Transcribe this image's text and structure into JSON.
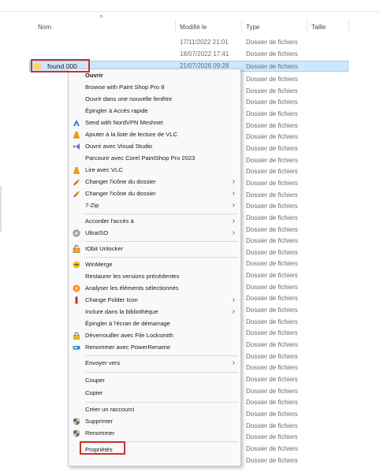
{
  "columns": {
    "name": "Nom",
    "modified": "Modifié le",
    "type": "Type",
    "size": "Taille"
  },
  "rows": [
    {
      "date": "17/11/2022 21:01",
      "type": "Dossier de fichiers"
    },
    {
      "date": "18/07/2022 17:41",
      "type": "Dossier de fichiers"
    }
  ],
  "selected_row": {
    "name": "found.000",
    "date": "21/07/2026 09:28",
    "type": "Dossier de fichiers"
  },
  "type_column_repeat": "Dossier de fichiers",
  "context_menu": {
    "items": [
      {
        "label": "Ouvrir",
        "bold": true
      },
      {
        "label": "Browse with Paint Shop Pro 8"
      },
      {
        "label": "Ouvrir dans une nouvelle fenêtre"
      },
      {
        "label": "Épingler à Accès rapide"
      },
      {
        "label": "Send with NordVPN Meshnet",
        "icon": "nordvpn-icon"
      },
      {
        "label": "Ajouter à la liste de lecture de VLC",
        "icon": "vlc-icon"
      },
      {
        "label": "Ouvrir avec Visual Studio",
        "icon": "visual-studio-icon"
      },
      {
        "label": "Parcourir avec Corel PaintShop Pro 2023"
      },
      {
        "label": "Lire avec VLC",
        "icon": "vlc-icon"
      },
      {
        "label": "Changer l'icône du dossier",
        "icon": "folder-paint-icon",
        "submenu": true
      },
      {
        "label": "Changer l'icône du dossier",
        "icon": "folder-paint-icon",
        "submenu": true
      },
      {
        "label": "7-Zip",
        "submenu": true
      },
      {
        "label": "Accorder l'accès à",
        "submenu": true
      },
      {
        "label": "UltraISO",
        "icon": "ultraiso-icon",
        "submenu": true
      },
      {
        "label": "IObit Unlocker",
        "icon": "iobit-unlocker-icon"
      },
      {
        "label": "WinMerge",
        "icon": "winmerge-icon"
      },
      {
        "label": "Restaurer les versions précédentes"
      },
      {
        "label": "Analyser les éléments sélectionnés",
        "icon": "scan-icon"
      },
      {
        "label": "Change Folder Icon",
        "icon": "change-folder-icon",
        "submenu": true
      },
      {
        "label": "Inclure dans la bibliothèque",
        "submenu": true
      },
      {
        "label": "Épingler à l'écran de démarrage"
      },
      {
        "label": "Déverrouiller avec File Locksmith",
        "icon": "lock-icon"
      },
      {
        "label": "Renommer avec PowerRename",
        "icon": "power-rename-icon"
      },
      {
        "label": "Envoyer vers",
        "submenu": true
      },
      {
        "label": "Couper"
      },
      {
        "label": "Copier"
      },
      {
        "label": "Créer un raccourci"
      },
      {
        "label": "Supprimer",
        "icon": "shield-icon"
      },
      {
        "label": "Renommer",
        "icon": "shield-icon"
      },
      {
        "label": "Propriétés"
      }
    ]
  },
  "colors": {
    "selection": "#cce8ff",
    "highlight_box": "#c8312c",
    "menu_bg": "#f9f9f9"
  }
}
